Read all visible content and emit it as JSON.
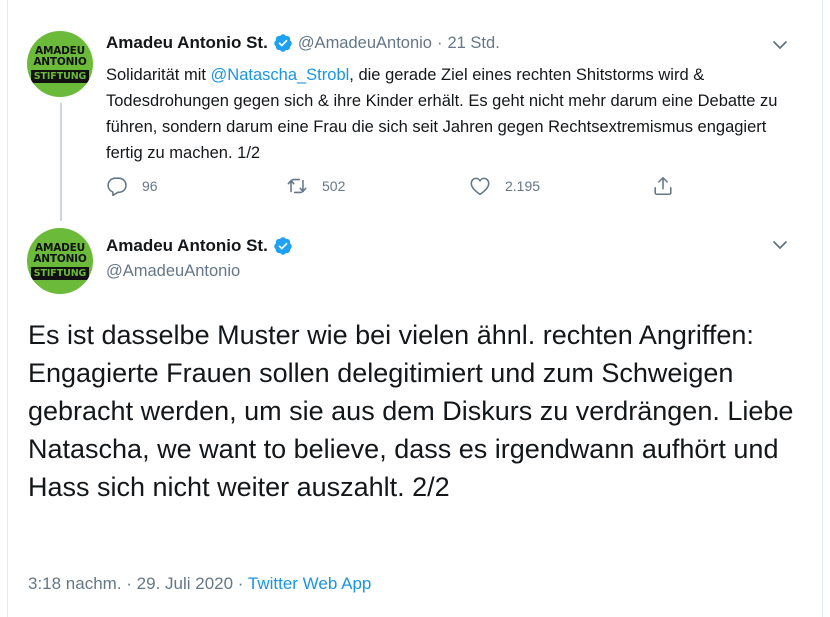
{
  "colors": {
    "brand_green": "#6cba3a",
    "verified_blue": "#1da1f2",
    "link_blue": "#1b95e0",
    "muted_gray": "#657786"
  },
  "avatar": {
    "line1": "AMADEU",
    "line2": "ANTONIO",
    "line3": "STIFTUNG"
  },
  "tweet1": {
    "display_name": "Amadeu Antonio St.",
    "handle": "@AmadeuAntonio",
    "separator": "·",
    "time": "21 Std.",
    "text_before": "Solidarität mit ",
    "mention": "@Natascha_Strobl",
    "text_after": ", die gerade Ziel eines rechten Shitstorms wird & Todesdrohungen gegen sich & ihre Kinder erhält. Es geht nicht mehr darum eine Debatte zu führen, sondern darum eine Frau die sich seit Jahren gegen Rechtsextremismus engagiert fertig zu machen. 1/2",
    "actions": {
      "reply_icon": "reply-icon",
      "reply_count": "96",
      "retweet_icon": "retweet-icon",
      "retweet_count": "502",
      "like_icon": "heart-icon",
      "like_count": "2.195",
      "share_icon": "share-icon"
    }
  },
  "tweet2": {
    "display_name": "Amadeu Antonio St.",
    "handle": "@AmadeuAntonio",
    "text": "Es ist dasselbe Muster wie bei vielen ähnl. rechten Angriffen: Engagierte Frauen sollen delegitimiert und zum Schweigen gebracht werden, um sie aus dem Diskurs zu verdrängen. Liebe Natascha, we want to believe, dass es irgendwann aufhört und Hass sich nicht weiter auszahlt. 2/2",
    "timestamp": "3:18 nachm. · 29. Juli 2020",
    "meta_separator": " · ",
    "source": "Twitter Web App"
  }
}
